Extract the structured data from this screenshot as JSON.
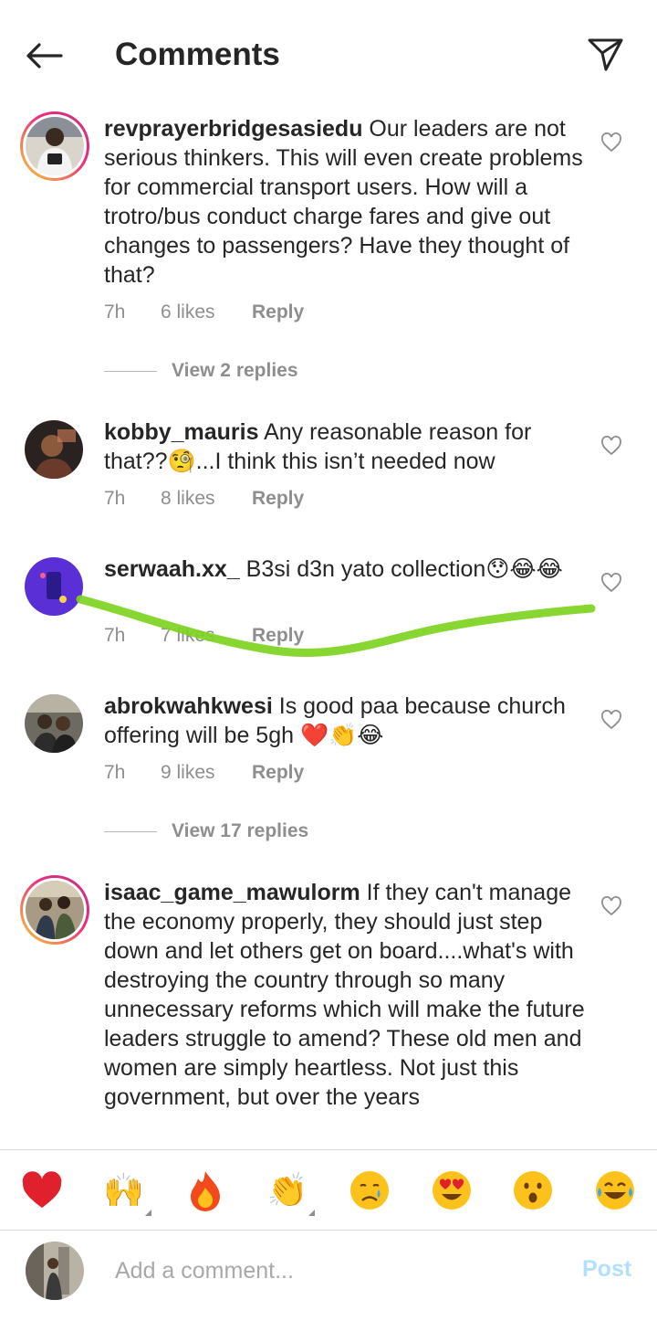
{
  "header": {
    "title": "Comments",
    "back_icon": "arrow-left-icon",
    "send_icon": "paper-plane-icon"
  },
  "comments": [
    {
      "username": "revprayerbridgesasiedu",
      "text": " Our leaders are not serious thinkers. This will even create problems for commercial transport users. How will a trotro/bus conduct charge fares and give out changes to passengers? Have they thought of that?",
      "time": "7h",
      "likes": "6 likes",
      "reply": "Reply",
      "has_story_ring": true
    },
    {
      "username": "kobby_mauris",
      "text": " Any reasonable reason for that??🧐...I think this isn’t needed now",
      "time": "7h",
      "likes": "8 likes",
      "reply": "Reply",
      "has_story_ring": false
    },
    {
      "username": "serwaah.xx_",
      "text": " B3si d3n yato collection😯😂😂",
      "time": "7h",
      "likes": "7 likes",
      "reply": "Reply",
      "has_story_ring": false
    },
    {
      "username": "abrokwahkwesi",
      "text": " Is good paa because church offering will be 5gh ❤️👏😂",
      "time": "7h",
      "likes": "9 likes",
      "reply": "Reply",
      "has_story_ring": false
    },
    {
      "username": "isaac_game_mawulorm",
      "text": " If they can't manage the economy properly, they should just step down and let others get on board....what's with destroying the country through so many unnecessary reforms which will make the future leaders struggle to amend? These old men and women are simply heartless. Not just this government, but over the years",
      "has_story_ring": true
    }
  ],
  "view_replies": [
    "View 2 replies",
    "View 17 replies"
  ],
  "reactions": [
    "❤️",
    "🙌",
    "🔥",
    "👏",
    "😢",
    "😍",
    "😮",
    "😂"
  ],
  "composer": {
    "placeholder": "Add a comment...",
    "post_label": "Post"
  },
  "colors": {
    "scribble": "#7ed321",
    "post": "#b2dffc",
    "meta": "#8e8e8e"
  }
}
